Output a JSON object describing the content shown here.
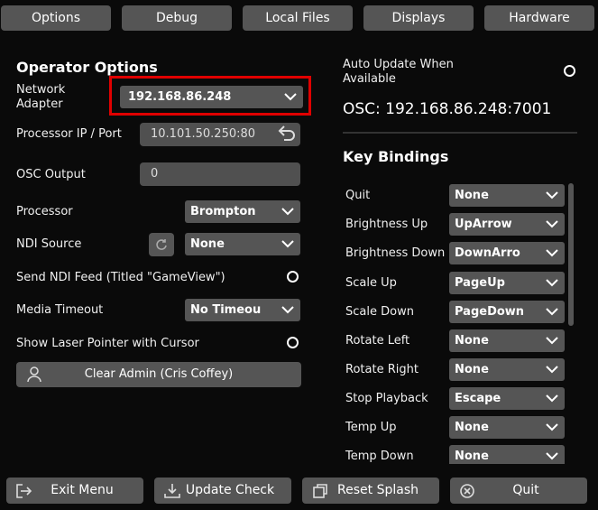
{
  "tabs": [
    "Options",
    "Debug",
    "Local Files",
    "Displays",
    "Hardware"
  ],
  "operator": {
    "title": "Operator Options",
    "network_adapter_label": "Network\nAdapter",
    "network_adapter_value": "192.168.86.248",
    "processor_ip_label": "Processor IP / Port",
    "processor_ip_value": "10.101.50.250:80",
    "osc_output_label": "OSC Output",
    "osc_output_value": "0",
    "processor_label": "Processor",
    "processor_value": "Brompton",
    "ndi_source_label": "NDI Source",
    "ndi_source_value": "None",
    "send_ndi_label": "Send NDI Feed (Titled \"GameView\")",
    "media_timeout_label": "Media Timeout",
    "media_timeout_value": "No Timeou",
    "laser_pointer_label": "Show Laser Pointer with Cursor",
    "clear_admin_label": "Clear Admin (Cris Coffey)"
  },
  "right": {
    "auto_update_label": "Auto Update When\nAvailable",
    "osc_text": "OSC: 192.168.86.248:7001",
    "key_bindings_title": "Key Bindings",
    "bindings": [
      {
        "label": "Quit",
        "value": "None"
      },
      {
        "label": "Brightness Up",
        "value": "UpArrow"
      },
      {
        "label": "Brightness Down",
        "value": "DownArro"
      },
      {
        "label": "Scale Up",
        "value": "PageUp"
      },
      {
        "label": "Scale Down",
        "value": "PageDown"
      },
      {
        "label": "Rotate Left",
        "value": "None"
      },
      {
        "label": "Rotate Right",
        "value": "None"
      },
      {
        "label": "Stop Playback",
        "value": "Escape"
      },
      {
        "label": "Temp Up",
        "value": "None"
      },
      {
        "label": "Temp Down",
        "value": "None"
      }
    ]
  },
  "bottom": {
    "exit": "Exit Menu",
    "update": "Update Check",
    "splash": "Reset Splash",
    "quit": "Quit"
  },
  "colors": {
    "highlight": "#e00000",
    "button": "#555555",
    "background": "#0a0a0a"
  },
  "icons": [
    "chevron-down-icon",
    "undo-arrow-icon",
    "refresh-icon",
    "user-icon",
    "exit-icon",
    "download-icon",
    "reset-icon",
    "close-circle-icon"
  ]
}
